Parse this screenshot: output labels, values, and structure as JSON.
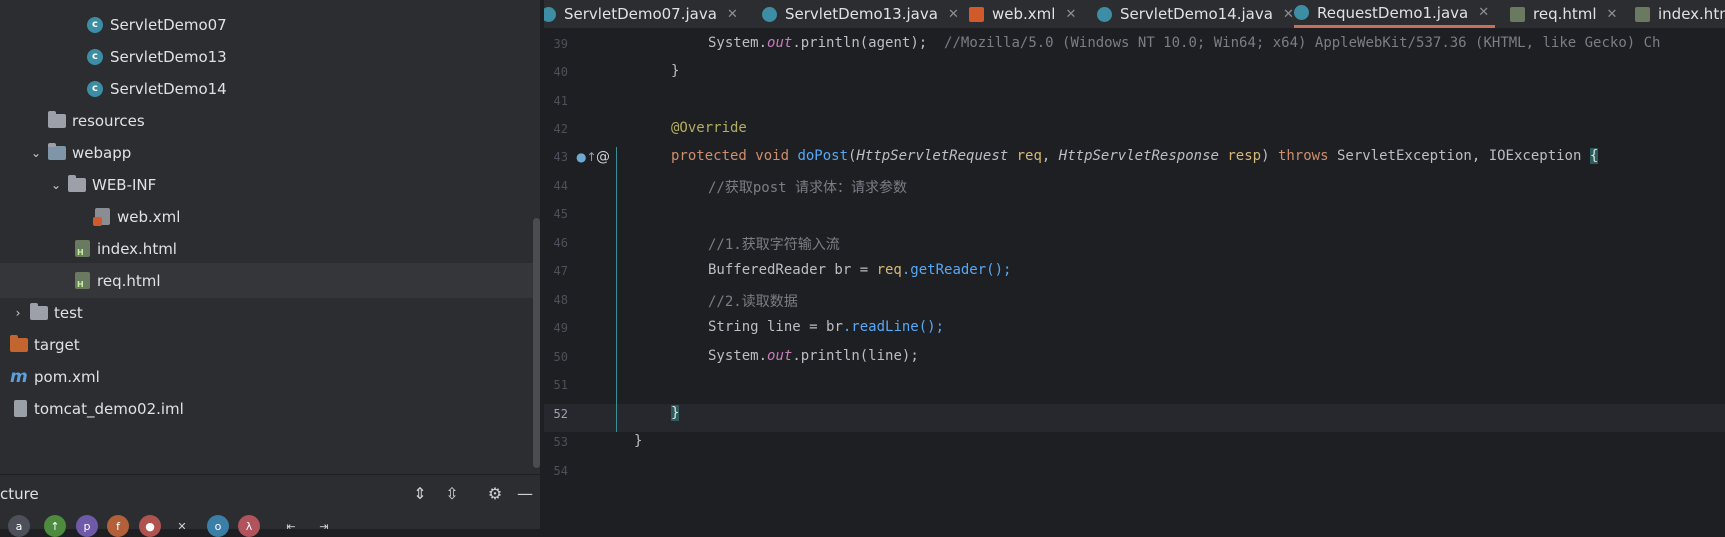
{
  "project_tree": {
    "items": [
      {
        "label": "ServletDemo07",
        "kind": "class"
      },
      {
        "label": "ServletDemo13",
        "kind": "class"
      },
      {
        "label": "ServletDemo14",
        "kind": "class"
      },
      {
        "label": "resources",
        "kind": "folder"
      },
      {
        "label": "webapp",
        "kind": "folder",
        "expanded": true
      },
      {
        "label": "WEB-INF",
        "kind": "folder",
        "expanded": true
      },
      {
        "label": "web.xml",
        "kind": "xml"
      },
      {
        "label": "index.html",
        "kind": "html"
      },
      {
        "label": "req.html",
        "kind": "html",
        "selected": true
      },
      {
        "label": "test",
        "kind": "folder",
        "expanded": false
      },
      {
        "label": "target",
        "kind": "folder"
      },
      {
        "label": "pom.xml",
        "kind": "maven"
      },
      {
        "label": "tomcat_demo02.iml",
        "kind": "iml"
      }
    ]
  },
  "structure_panel": {
    "title": "cture"
  },
  "tabs": [
    {
      "label": "ServletDemo07.java",
      "active": false
    },
    {
      "label": "ServletDemo13.java",
      "active": false
    },
    {
      "label": "web.xml",
      "active": false
    },
    {
      "label": "ServletDemo14.java",
      "active": false
    },
    {
      "label": "RequestDemo1.java",
      "active": true
    },
    {
      "label": "req.html",
      "active": false
    },
    {
      "label": "index.htm",
      "active": false
    }
  ],
  "editor": {
    "line_numbers": [
      "39",
      "40",
      "41",
      "42",
      "43",
      "44",
      "45",
      "46",
      "47",
      "48",
      "49",
      "50",
      "51",
      "52",
      "53",
      "54"
    ],
    "current_line": "52",
    "lines": {
      "l39_a": "System.",
      "l39_b": "out",
      "l39_c": ".println(agent);",
      "l39_comment": "//Mozilla/5.0 (Windows NT 10.0; Win64; x64) AppleWebKit/537.36 (KHTML, like Gecko) Ch",
      "l40": "}",
      "l42": "@Override",
      "l43_kw1": "protected",
      "l43_kw2": "void",
      "l43_name": "doPost",
      "l43_t1": "HttpServletRequest",
      "l43_p1": "req",
      "l43_t2": "HttpServletResponse",
      "l43_p2": "resp",
      "l43_kw3": "throws",
      "l43_e1": "ServletException",
      "l43_e2": "IOException",
      "l43_brace": "{",
      "l44": "//获取post 请求体：请求参数",
      "l46": "//1.获取字符输入流",
      "l47_a": "BufferedReader br = ",
      "l47_b": "req",
      "l47_c": ".getReader();",
      "l48": "//2.读取数据",
      "l49_a": "String line = ",
      "l49_b": "br",
      "l49_c": ".readLine();",
      "l50_a": "System.",
      "l50_b": "out",
      "l50_c": ".println(",
      "l50_d": "line",
      "l50_e": ");",
      "l52": "}",
      "l53": "}"
    }
  }
}
